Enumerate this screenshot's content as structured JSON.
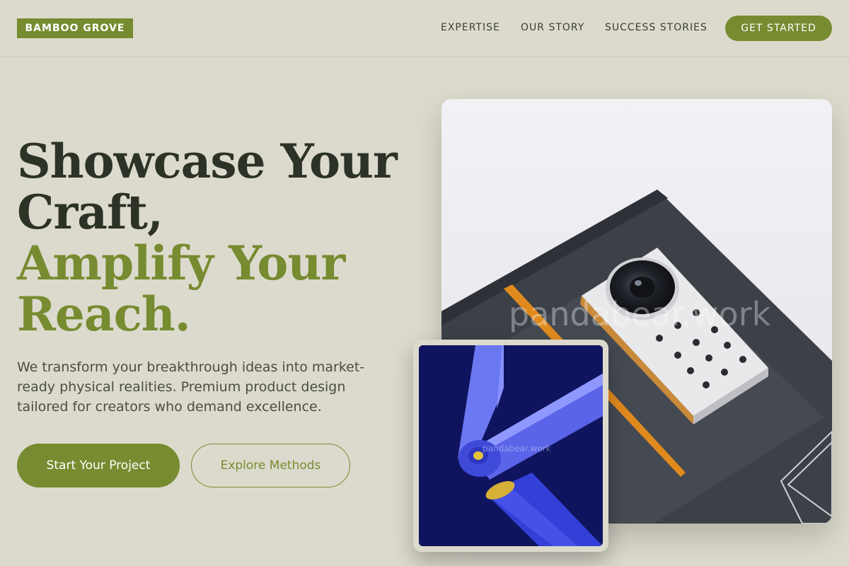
{
  "header": {
    "logo": "BAMBOO GROVE",
    "nav": [
      "EXPERTISE",
      "OUR STORY",
      "SUCCESS STORIES"
    ],
    "cta": "GET STARTED"
  },
  "hero": {
    "headline_dark_1": "Showcase Your",
    "headline_dark_2": "Craft,",
    "headline_green_1": "Amplify Your",
    "headline_green_2": "Reach.",
    "description": "We transform your breakthrough ideas into market-ready physical realities. Premium product design tailored for creators who demand excellence.",
    "primary_button": "Start Your Project",
    "secondary_button": "Explore Methods"
  },
  "images": {
    "main_watermark": "pandabear.work",
    "thumb_watermark": "pandabear.work"
  },
  "colors": {
    "background": "#dcdacd",
    "accent": "#778b30",
    "text_dark": "#2c3226"
  }
}
